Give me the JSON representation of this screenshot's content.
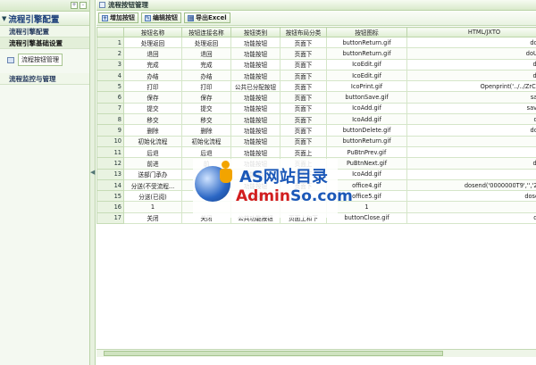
{
  "sidebar": {
    "root_title": "流程引擎配置",
    "sections": [
      {
        "label": "流程引擎配置"
      },
      {
        "label": "流程引擎基础设置"
      },
      {
        "label": "流程监控与管理"
      }
    ],
    "active_item": "流程按钮管理"
  },
  "window": {
    "title": "流程按钮管理"
  },
  "toolbar": {
    "add_label": "增加按钮",
    "edit_label": "编辑按钮",
    "export_label": "导出Excel"
  },
  "grid": {
    "columns": [
      "",
      "按钮名称",
      "按钮连接名称",
      "按钮类别",
      "按钮布局分类",
      "按钮图标",
      "HTML/JXTO"
    ],
    "rows": [
      [
        "1",
        "处理返回",
        "处理返回",
        "功能按钮",
        "页面下",
        "buttonReturn.gif",
        "doReturn("
      ],
      [
        "2",
        "退回",
        "退回",
        "功能按钮",
        "页面下",
        "buttonReturn.gif",
        "doUntread("
      ],
      [
        "3",
        "完成",
        "完成",
        "功能按钮",
        "页面下",
        "IcoEdit.gif",
        "doFinish("
      ],
      [
        "4",
        "办结",
        "办结",
        "功能按钮",
        "页面下",
        "IcoEdit.gif",
        "doFinish("
      ],
      [
        "5",
        "打印",
        "打印",
        "公共已分配按钮",
        "页面下",
        "IcoPrint.gif",
        "Openprint('../../ZrCellEngin"
      ],
      [
        "6",
        "保存",
        "保存",
        "功能按钮",
        "页面下",
        "buttonSave.gif",
        "saveCell('"
      ],
      [
        "7",
        "提交",
        "提交",
        "功能按钮",
        "页面下",
        "IcoAdd.gif",
        "saveCell('2"
      ],
      [
        "8",
        "移交",
        "移交",
        "功能按钮",
        "页面下",
        "IcoAdd.gif",
        "devolve("
      ],
      [
        "9",
        "删除",
        "删除",
        "功能按钮",
        "页面下",
        "buttonDelete.gif",
        "doDelete("
      ],
      [
        "10",
        "初始化流程",
        "初始化流程",
        "功能按钮",
        "页面下",
        "buttonReturn.gif",
        "doInit("
      ],
      [
        "11",
        "后退",
        "后退",
        "功能按钮",
        "页面上",
        "PuBtnPrev.gif",
        "doUp();"
      ],
      [
        "12",
        "前进",
        "前",
        "功能按钮",
        "页面上",
        "PuBtnNext.gif",
        "doDown("
      ],
      [
        "13",
        "送部门承办",
        "送部",
        "功能按钮",
        "页面下",
        "IcoAdd.gif",
        "dodept("
      ],
      [
        "14",
        "分送(不受流程...",
        "分",
        "功能按钮",
        "页面下",
        "office4.gif",
        "dosend('0000000T9','','2','','0');/"
      ],
      [
        "15",
        "分送(已阅)",
        "已",
        "功能按钮",
        "页面下",
        "office5.gif",
        "dosendFinis"
      ],
      [
        "16",
        "1",
        "",
        "",
        "",
        "1",
        ""
      ],
      [
        "17",
        "关闭",
        "关闭",
        "公共功能按钮",
        "页面上和下",
        "buttonClose.gif",
        "doClose("
      ]
    ]
  },
  "watermark": {
    "line1": "AS网站目录",
    "line2_a": "Admin",
    "line2_b": "So.com"
  }
}
